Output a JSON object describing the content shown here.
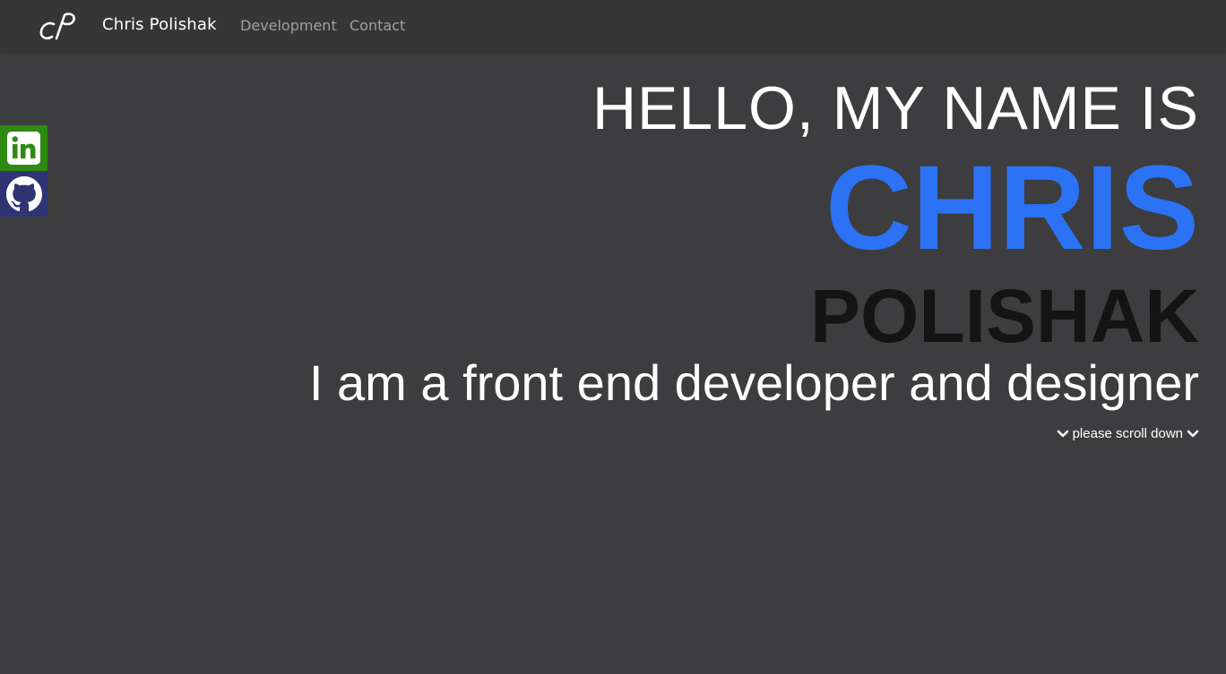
{
  "navbar": {
    "brand_name": "Chris Polishak",
    "links": [
      {
        "label": "Development"
      },
      {
        "label": "Contact"
      }
    ]
  },
  "social": [
    {
      "icon": "linkedin-icon",
      "color": "#2f8a12"
    },
    {
      "icon": "github-icon",
      "color": "#2f3472"
    }
  ],
  "hero": {
    "greeting": "HELLO, MY NAME IS",
    "first_name": "CHRIS",
    "last_name": "POLISHAK",
    "tagline": "I am a front end developer and designer",
    "scroll_hint": "please scroll down"
  },
  "colors": {
    "background": "#3d3d3f",
    "navbar": "#363636",
    "accent": "#2b72f5",
    "last_name": "#141414"
  }
}
